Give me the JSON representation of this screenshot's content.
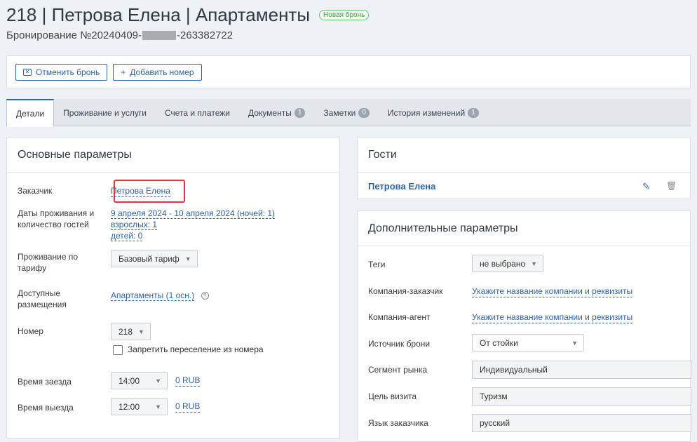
{
  "header": {
    "title": "218 | Петрова Елена | Апартаменты",
    "badge": "Новая бронь",
    "booking_prefix": "Бронирование №20240409-",
    "booking_suffix": "-263382722"
  },
  "actions": {
    "cancel_label": "Отменить бронь",
    "add_label": "Добавить номер"
  },
  "tabs": [
    {
      "label": "Детали",
      "count": ""
    },
    {
      "label": "Проживание и услуги",
      "count": ""
    },
    {
      "label": "Счета и платежи",
      "count": ""
    },
    {
      "label": "Документы",
      "count": "1"
    },
    {
      "label": "Заметки",
      "count": "0"
    },
    {
      "label": "История изменений",
      "count": "1"
    }
  ],
  "main_params": {
    "title": "Основные параметры",
    "customer_label": "Заказчик",
    "customer_value": "Петрова Елена",
    "dates_label": "Даты проживания и количество гостей",
    "dates_value": "9 апреля 2024 - 10 апреля 2024 (ночей: 1)",
    "adults_value": "взрослых: 1",
    "children_value": "детей: 0",
    "tariff_label": "Проживание по тарифу",
    "tariff_value": "Базовый тариф",
    "placement_label": "Доступные размещения",
    "placement_value": "Апартаменты (1 осн.)",
    "room_label": "Номер",
    "room_value": "218",
    "forbid_move_label": "Запретить переселение из номера",
    "checkin_label": "Время заезда",
    "checkin_value": "14:00",
    "checkin_price": "0 RUB",
    "checkout_label": "Время выезда",
    "checkout_value": "12:00",
    "checkout_price": "0 RUB"
  },
  "guests": {
    "title": "Гости",
    "guest_name": "Петрова Елена"
  },
  "extra_params": {
    "title": "Дополнительные параметры",
    "tags_label": "Теги",
    "tags_value": "не выбрано",
    "company_label": "Компания-заказчик",
    "company_value": "Укажите название компании и реквизиты",
    "agent_label": "Компания-агент",
    "agent_value": "Укажите название компании и реквизиты",
    "source_label": "Источник брони",
    "source_value": "От стойки",
    "segment_label": "Сегмент рынка",
    "segment_value": "Индивидуальный",
    "purpose_label": "Цель визита",
    "purpose_value": "Туризм",
    "language_label": "Язык заказчика",
    "language_value": "русский"
  },
  "colors": {
    "accent": "#2d64a8",
    "highlight": "#d93a3a",
    "badge_green": "#3f9a4a"
  }
}
